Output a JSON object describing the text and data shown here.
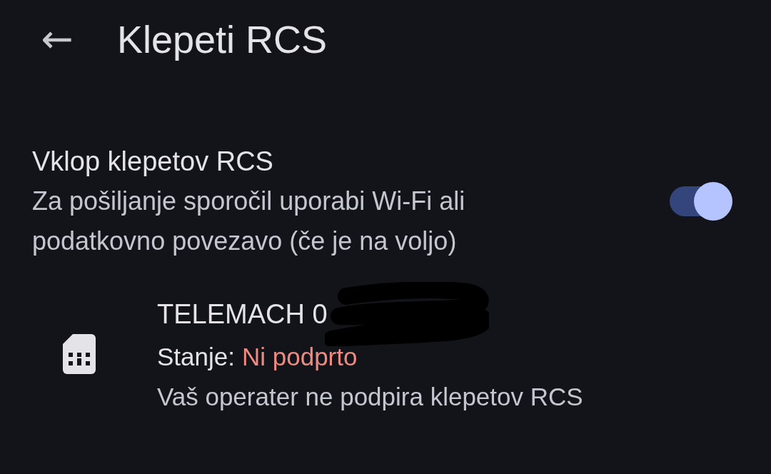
{
  "header": {
    "back_icon": "←",
    "title": "Klepeti RCS"
  },
  "rcs_setting": {
    "title": "Vklop klepetov RCS",
    "description": "Za pošiljanje sporočil uporabi Wi-Fi ali podatkovno povezavo (če je na voljo)",
    "on": true
  },
  "sim": {
    "name": "TELEMACH 0",
    "status_label": "Stanje:",
    "status_value": "Ni podprto",
    "status_supported": false,
    "note": "Vaš operater ne podpira klepetov RCS"
  }
}
